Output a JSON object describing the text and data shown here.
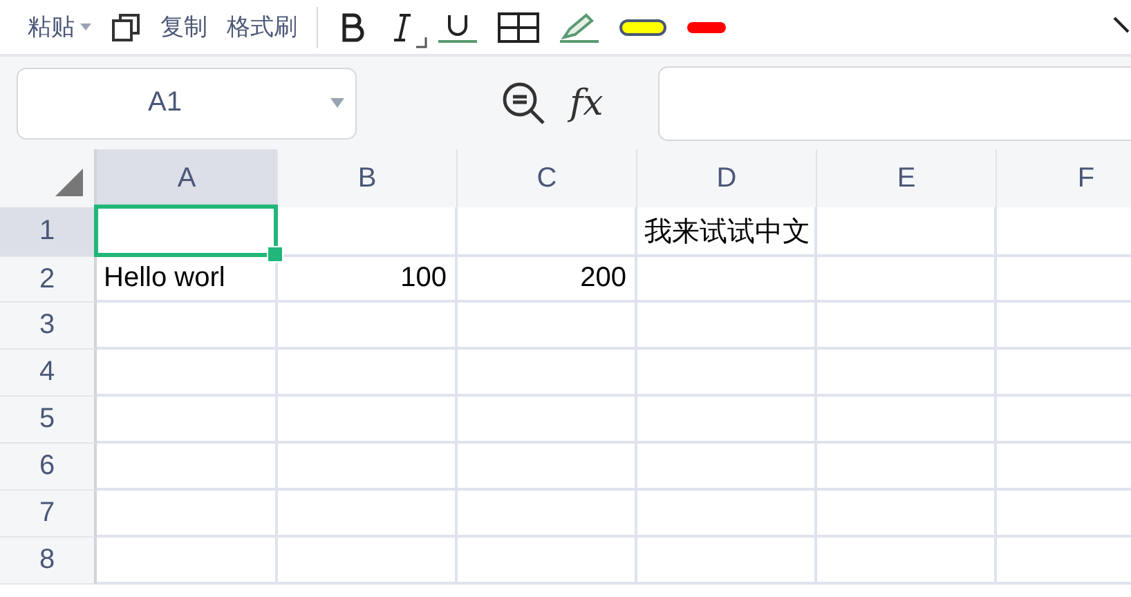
{
  "toolbar": {
    "paste": "粘贴",
    "copy": "复制",
    "format_painter": "格式刷"
  },
  "name_box": {
    "value": "A1"
  },
  "formula_label": "fx",
  "columns": [
    {
      "label": "A",
      "selected": true
    },
    {
      "label": "B",
      "selected": false
    },
    {
      "label": "C",
      "selected": false
    },
    {
      "label": "D",
      "selected": false
    },
    {
      "label": "E",
      "selected": false
    },
    {
      "label": "F",
      "selected": false
    }
  ],
  "rows": [
    {
      "label": "1",
      "selected": true,
      "cells": [
        {
          "kind": "empty"
        },
        {
          "kind": "empty"
        },
        {
          "kind": "empty"
        },
        {
          "kind": "text",
          "value": "我来试试中文"
        },
        {
          "kind": "empty"
        },
        {
          "kind": "empty"
        }
      ]
    },
    {
      "label": "2",
      "selected": false,
      "cells": [
        {
          "kind": "text",
          "value": "Hello worl"
        },
        {
          "kind": "number",
          "value": "100"
        },
        {
          "kind": "number",
          "value": "200"
        },
        {
          "kind": "empty"
        },
        {
          "kind": "empty"
        },
        {
          "kind": "empty"
        }
      ]
    },
    {
      "label": "3",
      "selected": false
    },
    {
      "label": "4",
      "selected": false
    },
    {
      "label": "5",
      "selected": false
    },
    {
      "label": "6",
      "selected": false
    },
    {
      "label": "7",
      "selected": false
    },
    {
      "label": "8",
      "selected": false
    }
  ]
}
